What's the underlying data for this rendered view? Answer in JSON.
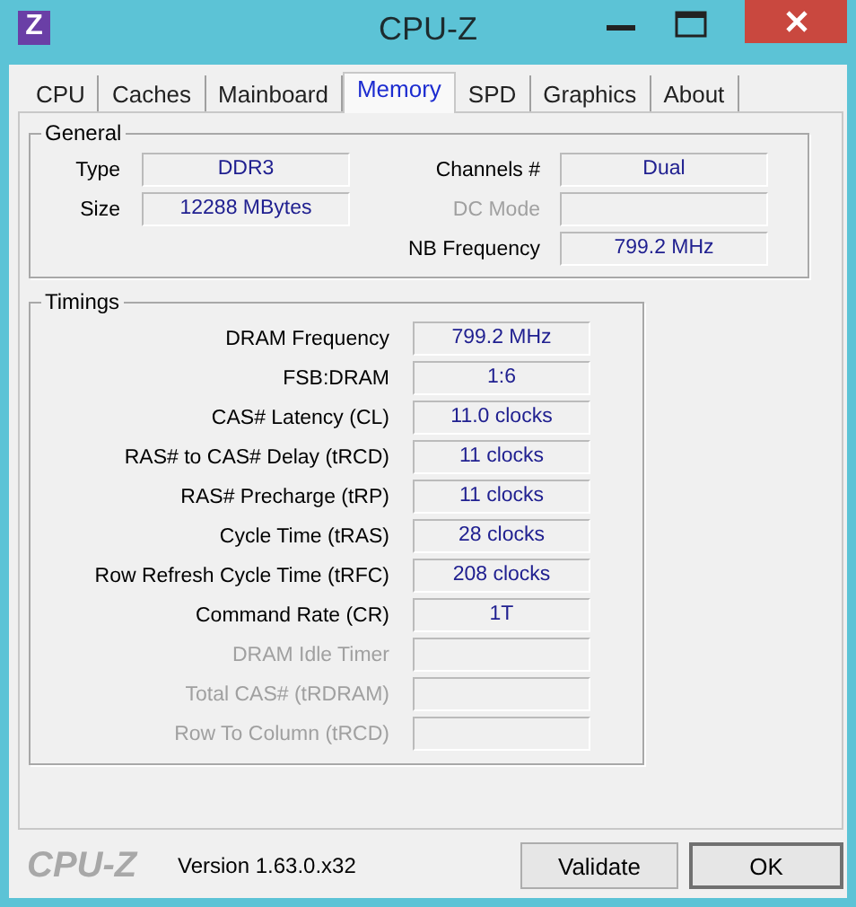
{
  "window": {
    "title": "CPU-Z",
    "icon_letter": "Z"
  },
  "tabs": [
    {
      "label": "CPU",
      "selected": false
    },
    {
      "label": "Caches",
      "selected": false
    },
    {
      "label": "Mainboard",
      "selected": false
    },
    {
      "label": "Memory",
      "selected": true
    },
    {
      "label": "SPD",
      "selected": false
    },
    {
      "label": "Graphics",
      "selected": false
    },
    {
      "label": "About",
      "selected": false
    }
  ],
  "general": {
    "title": "General",
    "left": [
      {
        "label": "Type",
        "value": "DDR3",
        "disabled": false
      },
      {
        "label": "Size",
        "value": "12288 MBytes",
        "disabled": false
      }
    ],
    "right": [
      {
        "label": "Channels #",
        "value": "Dual",
        "disabled": false
      },
      {
        "label": "DC Mode",
        "disabled": true
      },
      {
        "label": "NB Frequency",
        "value": "799.2 MHz",
        "disabled": false
      }
    ]
  },
  "timings": {
    "title": "Timings",
    "rows": [
      {
        "label": "DRAM Frequency",
        "value": "799.2 MHz",
        "disabled": false
      },
      {
        "label": "FSB:DRAM",
        "value": "1:6",
        "disabled": false
      },
      {
        "label": "CAS# Latency (CL)",
        "value": "11.0 clocks",
        "disabled": false
      },
      {
        "label": "RAS# to CAS# Delay (tRCD)",
        "value": "11 clocks",
        "disabled": false
      },
      {
        "label": "RAS# Precharge (tRP)",
        "value": "11 clocks",
        "disabled": false
      },
      {
        "label": "Cycle Time (tRAS)",
        "value": "28 clocks",
        "disabled": false
      },
      {
        "label": "Row Refresh Cycle Time (tRFC)",
        "value": "208 clocks",
        "disabled": false
      },
      {
        "label": "Command Rate (CR)",
        "value": "1T",
        "disabled": false
      },
      {
        "label": "DRAM Idle Timer",
        "disabled": true
      },
      {
        "label": "Total CAS# (tRDRAM)",
        "disabled": true
      },
      {
        "label": "Row To Column (tRCD)",
        "disabled": true
      }
    ]
  },
  "footer": {
    "logo": "CPU-Z",
    "version": "Version 1.63.0.x32",
    "buttons": [
      "Validate",
      "OK"
    ]
  }
}
